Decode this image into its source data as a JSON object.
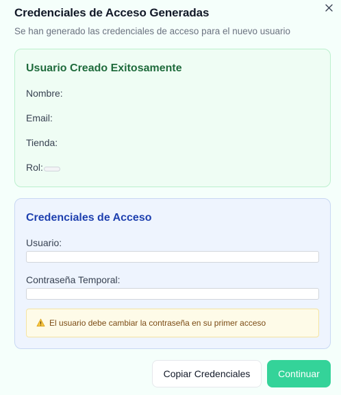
{
  "dialog": {
    "title": "Credenciales de Acceso Generadas",
    "subtitle": "Se han generado las credenciales de acceso para el nuevo usuario"
  },
  "user_card": {
    "title": "Usuario Creado Exitosamente",
    "name_label": "Nombre:",
    "name_value": "",
    "email_label": "Email:",
    "email_value": "",
    "store_label": "Tienda:",
    "store_value": "",
    "role_label": "Rol:",
    "role_value": ""
  },
  "credentials_card": {
    "title": "Credenciales de Acceso",
    "username_label": "Usuario:",
    "username_value": "",
    "password_label": "Contraseña Temporal:",
    "password_value": "",
    "warning_text": "El usuario debe cambiar la contraseña en su primer acceso"
  },
  "actions": {
    "copy_label": "Copiar Credenciales",
    "continue_label": "Continuar"
  },
  "icons": {
    "close": "close-icon",
    "warning": "warning-icon"
  },
  "colors": {
    "success_bg": "#effdf4",
    "success_title": "#1f6b3c",
    "info_bg": "#eef4fe",
    "info_title": "#1e40af",
    "warning_bg": "#fefbe8",
    "primary_button": "#34d399"
  }
}
